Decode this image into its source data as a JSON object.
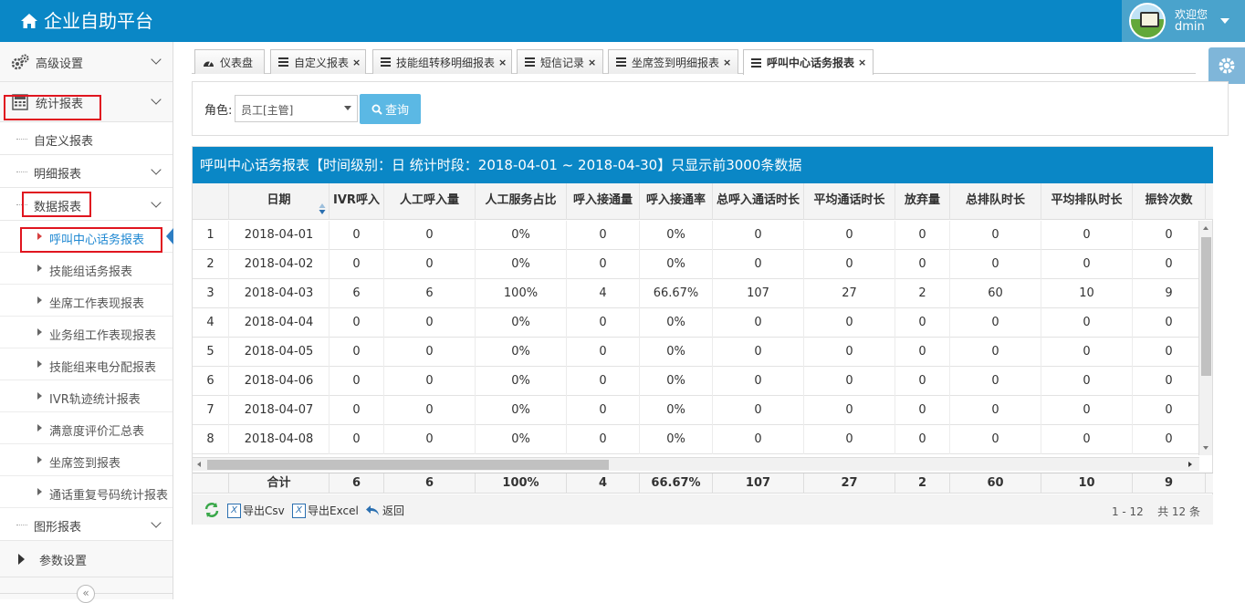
{
  "app": {
    "title": "企业自助平台"
  },
  "user": {
    "welcome": "欢迎您",
    "name": "dmin"
  },
  "sidebar": {
    "top_items": [
      {
        "label": "高级设置"
      },
      {
        "label": "统计报表"
      }
    ],
    "sub_items": {
      "custom": "自定义报表",
      "detail": "明细报表",
      "data": "数据报表",
      "graph": "图形报表"
    },
    "data_leaves": [
      "呼叫中心话务报表",
      "技能组话务报表",
      "坐席工作表现报表",
      "业务组工作表现报表",
      "技能组来电分配报表",
      "IVR轨迹统计报表",
      "满意度评价汇总表",
      "坐席签到报表",
      "通话重复号码统计报表"
    ],
    "param_settings": "参数设置",
    "collapse_glyph": "«"
  },
  "tabs": [
    {
      "label": "仪表盘",
      "icon": "dashboard-icon",
      "closable": false
    },
    {
      "label": "自定义报表",
      "icon": "list-icon",
      "closable": true
    },
    {
      "label": "技能组转移明细报表",
      "icon": "list-icon",
      "closable": true
    },
    {
      "label": "短信记录",
      "icon": "list-icon",
      "closable": true
    },
    {
      "label": "坐席签到明细报表",
      "icon": "list-icon",
      "closable": true
    },
    {
      "label": "呼叫中心话务报表",
      "icon": "list-icon",
      "closable": true,
      "active": true
    }
  ],
  "close_glyph": "×",
  "filter": {
    "role_label": "角色:",
    "role_value": "员工[主管]",
    "query_label": "查询"
  },
  "report": {
    "title": "呼叫中心话务报表【时间级别：日 统计时段：2018-04-01 ~ 2018-04-30】只显示前3000条数据",
    "columns": [
      "",
      "日期",
      "IVR呼入",
      "人工呼入量",
      "人工服务占比",
      "呼入接通量",
      "呼入接通率",
      "总呼入通话时长",
      "平均通话时长",
      "放弃量",
      "总排队时长",
      "平均排队时长",
      "振铃次数"
    ],
    "rows": [
      [
        "1",
        "2018-04-01",
        "0",
        "0",
        "0%",
        "0",
        "0%",
        "0",
        "0",
        "0",
        "0",
        "0",
        "0"
      ],
      [
        "2",
        "2018-04-02",
        "0",
        "0",
        "0%",
        "0",
        "0%",
        "0",
        "0",
        "0",
        "0",
        "0",
        "0"
      ],
      [
        "3",
        "2018-04-03",
        "6",
        "6",
        "100%",
        "4",
        "66.67%",
        "107",
        "27",
        "2",
        "60",
        "10",
        "9"
      ],
      [
        "4",
        "2018-04-04",
        "0",
        "0",
        "0%",
        "0",
        "0%",
        "0",
        "0",
        "0",
        "0",
        "0",
        "0"
      ],
      [
        "5",
        "2018-04-05",
        "0",
        "0",
        "0%",
        "0",
        "0%",
        "0",
        "0",
        "0",
        "0",
        "0",
        "0"
      ],
      [
        "6",
        "2018-04-06",
        "0",
        "0",
        "0%",
        "0",
        "0%",
        "0",
        "0",
        "0",
        "0",
        "0",
        "0"
      ],
      [
        "7",
        "2018-04-07",
        "0",
        "0",
        "0%",
        "0",
        "0%",
        "0",
        "0",
        "0",
        "0",
        "0",
        "0"
      ],
      [
        "8",
        "2018-04-08",
        "0",
        "0",
        "0%",
        "0",
        "0%",
        "0",
        "0",
        "0",
        "0",
        "0",
        "0"
      ]
    ],
    "totals": [
      "",
      "合计",
      "6",
      "6",
      "100%",
      "4",
      "66.67%",
      "107",
      "27",
      "2",
      "60",
      "10",
      "9"
    ]
  },
  "toolbar": {
    "export_csv": "导出Csv",
    "export_excel": "导出Excel",
    "back": "返回",
    "excel_glyph": "X",
    "pager_range": "1 - 12",
    "pager_total": "共 12 条"
  },
  "colors": {
    "header_blue": "#0a87c6",
    "highlight_red": "#e0151f",
    "button_blue": "#5bb8e4"
  }
}
